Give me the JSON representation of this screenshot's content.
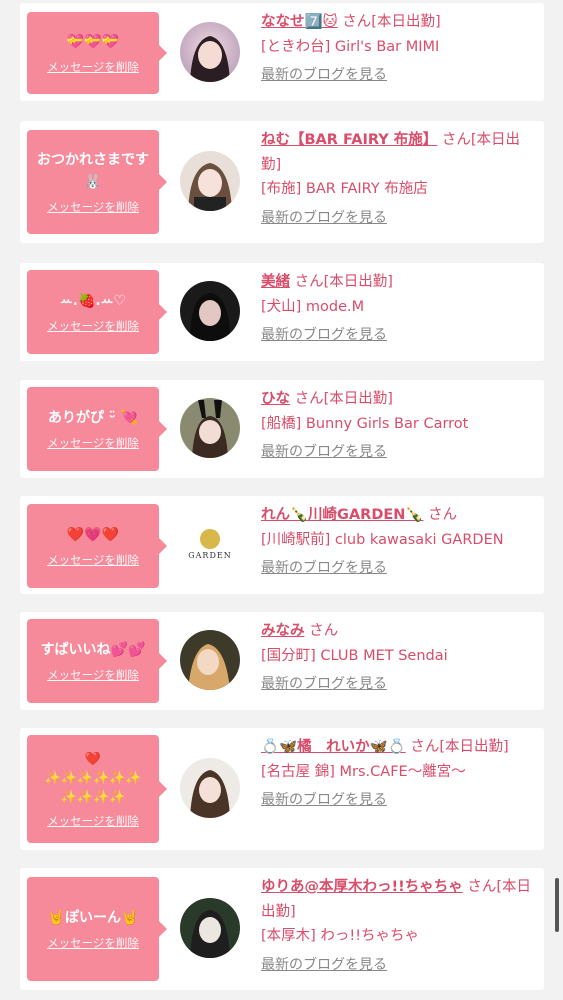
{
  "delete_label": "メッセージを削除",
  "blog_label": "最新のブログを見る",
  "san_suffix": "さん",
  "colors": {
    "accent": "#f6899a",
    "name": "#d94d6a",
    "background": "#f2f2f2"
  },
  "cards": [
    {
      "message": "💝💝💝",
      "name": "ななせ7️⃣🐱",
      "status": "[本日出勤]",
      "shop": "[ときわ台] Girl's Bar MIMI",
      "avatar_icon": "person-photo"
    },
    {
      "message": "おつかれさまです🐰",
      "name": "ねむ【BAR FAIRY 布施】",
      "status": "[本日出勤]",
      "shop": "[布施] BAR FAIRY 布施店",
      "avatar_icon": "person-photo"
    },
    {
      "message": "ꕀ.🍓.ꕀ♡",
      "name": "美緒",
      "status": "[本日出勤]",
      "shop": "[犬山] mode.M",
      "avatar_icon": "person-photo"
    },
    {
      "message": "ありがぴ ᵕ̈ 💘",
      "name": "ひな",
      "status": "[本日出勤]",
      "shop": "[船橋] Bunny Girls Bar Carrot",
      "avatar_icon": "person-photo"
    },
    {
      "message": "❤️💗❤️",
      "name": "れん🍾川崎GARDEN🍾",
      "status": "",
      "shop": "[川崎駅前] club kawasaki GARDEN",
      "avatar_icon": "garden-logo",
      "avatar_text": "GARDEN"
    },
    {
      "message": "すぱいいね💕💕",
      "name": "みなみ",
      "status": "",
      "shop": "[国分町] CLUB MET Sendai",
      "avatar_icon": "person-photo"
    },
    {
      "message": "❤️\n✨✨✨✨✨✨\n✨✨✨✨",
      "name": "💍🦋橘　れいか🦋💍",
      "status": "[本日出勤]",
      "shop": "[名古屋 錦] Mrs.CAFE〜離宮〜",
      "avatar_icon": "person-photo"
    },
    {
      "message": "🤘ぽいーん🤘",
      "name": "ゆりあ@本厚木わっ!!ちゃちゃ",
      "status": "[本日出勤]",
      "shop": "[本厚木] わっ!!ちゃちゃ",
      "avatar_icon": "person-photo"
    }
  ]
}
